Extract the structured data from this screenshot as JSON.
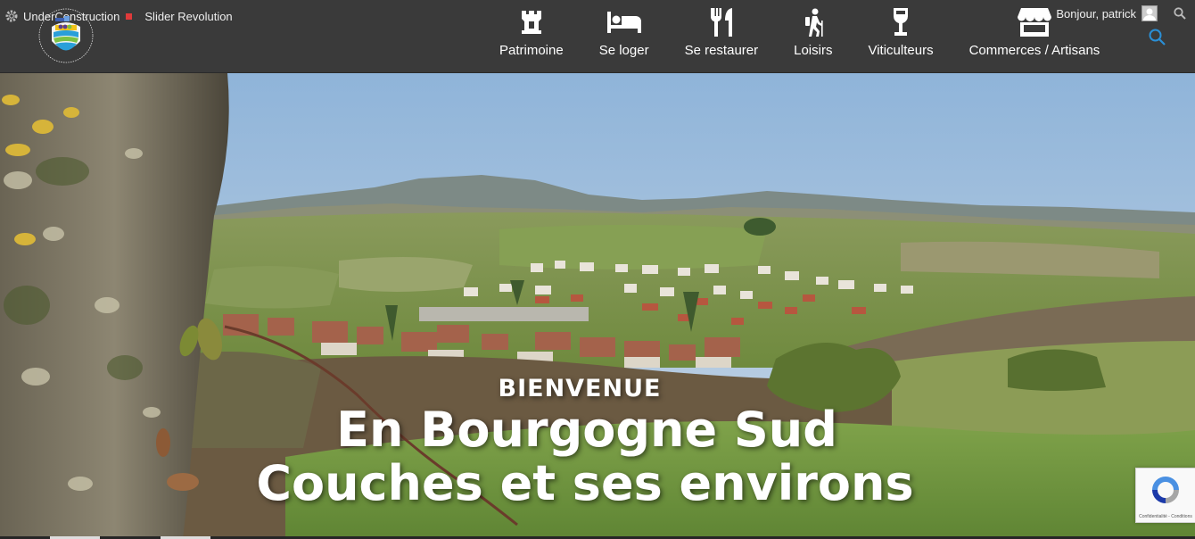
{
  "adminbar": {
    "site_name": "UnderConstruction",
    "plugin_link": "Slider Revolution",
    "greeting": "Bonjour, patrick"
  },
  "nav": {
    "items": [
      {
        "label": "Patrimoine",
        "icon": "castle-rook-icon"
      },
      {
        "label": "Se loger",
        "icon": "bed-icon"
      },
      {
        "label": "Se restaurer",
        "icon": "utensils-icon"
      },
      {
        "label": "Loisirs",
        "icon": "hiker-icon"
      },
      {
        "label": "Viticulteurs",
        "icon": "wine-glass-icon"
      },
      {
        "label": "Commerces / Artisans",
        "icon": "store-icon"
      }
    ]
  },
  "hero": {
    "kicker": "BIENVENUE",
    "line1": "En Bourgogne Sud",
    "line2": "Couches et ses environs"
  },
  "recaptcha": {
    "label": "Confidentialité - Conditions"
  },
  "colors": {
    "header_bg": "#3a3a3a",
    "accent_blue": "#2a8fd6",
    "admin_red": "#e03a3a"
  }
}
